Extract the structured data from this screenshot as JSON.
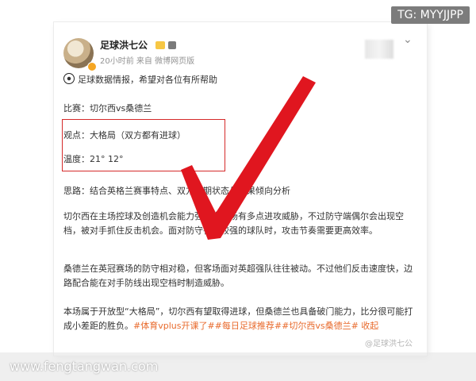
{
  "overlay": {
    "tg_label": "TG: MYYJJPP",
    "site_label": "www.fengtangwan.com"
  },
  "post": {
    "author": "足球洪七公",
    "meta": "20小时前 来自 微博网页版",
    "intro": "足球数据情报，希望对各位有所帮助",
    "match": "比赛：切尔西vs桑德兰",
    "view": "观点：大格局（双方都有进球）",
    "temp": "温度：21° 12°",
    "thoughts": "思路：结合英格兰赛事特点、双方近期状态与赛果倾向分析",
    "p1": "切尔西在主场控球及创造机会能力强，中前场有多点进攻威胁，不过防守端偶尔会出现空档，被对手抓住反击机会。面对防守韧性较强的球队时，攻击节奏需要更高效率。",
    "p2": "桑德兰在英冠赛场的防守相对稳，但客场面对英超强队往往被动。不过他们反击速度快，边路配合能在对手防线出现空档时制造威胁。",
    "p3_text": "本场属于开放型“大格局”，切尔西有望取得进球，但桑德兰也具备破门能力，比分很可能打成小差距的胜负。",
    "p3_tags": "#体育vplus开课了##每日足球推荐##切尔西vs桑德兰# 收起",
    "watermark": "@足球洪七公"
  },
  "icons": {
    "intro": "soccer-ball-icon",
    "more": "chevron-down-icon"
  },
  "colors": {
    "check": "#e0161f",
    "box": "#d52a2a",
    "tag": "#e86a2c"
  }
}
